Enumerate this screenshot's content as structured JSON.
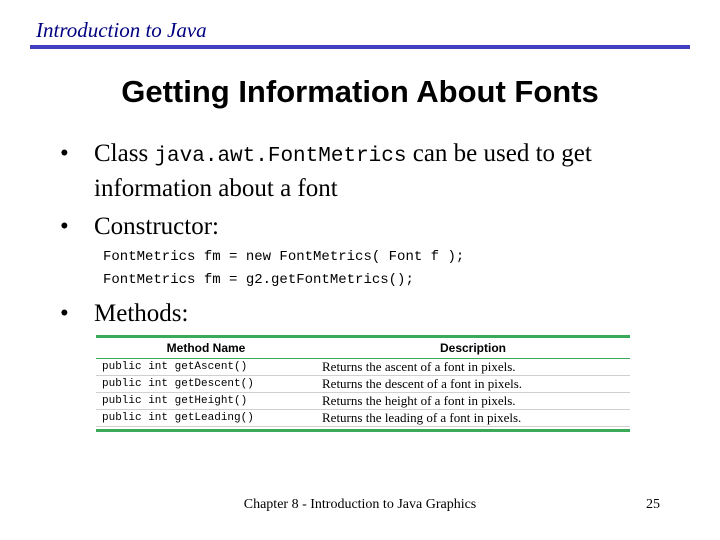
{
  "header": {
    "course_title": "Introduction to Java"
  },
  "slide": {
    "title": "Getting Information About Fonts",
    "bullets": {
      "class_prefix": "Class ",
      "class_code": "java.awt.FontMetrics",
      "class_suffix": " can be used to get",
      "class_line2": "information about a font",
      "constructor": "Constructor:",
      "methods": "Methods:"
    },
    "code_lines": [
      "FontMetrics fm = new FontMetrics( Font f );",
      "FontMetrics fm = g2.getFontMetrics();"
    ],
    "methods_table": {
      "headers": [
        "Method Name",
        "Description"
      ],
      "rows": [
        {
          "signature": "public int getAscent()",
          "description": "Returns the ascent of a font in pixels."
        },
        {
          "signature": "public int getDescent()",
          "description": "Returns the descent of a font in pixels."
        },
        {
          "signature": "public int getHeight()",
          "description": "Returns the height of a font in pixels."
        },
        {
          "signature": "public int getLeading()",
          "description": "Returns the leading of a font in pixels."
        }
      ]
    }
  },
  "footer": {
    "text": "Chapter 8 - Introduction to Java Graphics",
    "page_number": "25"
  }
}
